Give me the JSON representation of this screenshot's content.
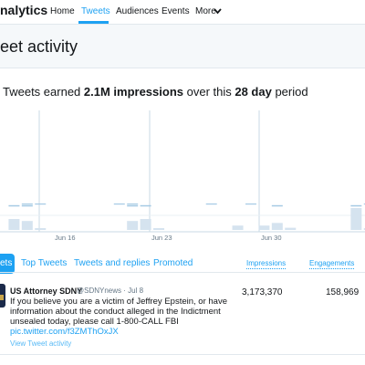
{
  "nav": {
    "brand": "nalytics",
    "items": [
      "Home",
      "Tweets",
      "Audiences",
      "Events",
      "More"
    ],
    "active": "Tweets"
  },
  "header": {
    "title": "eet activity"
  },
  "summary": {
    "prefix": "Tweets earned ",
    "impressions_value": "2.1M impressions",
    "middle": " over this ",
    "period": "28 day",
    "suffix": " period"
  },
  "chart_data": {
    "type": "bar",
    "x_tick_labels": [
      "Jun 16",
      "Jun 23",
      "Jun 30"
    ],
    "values": [
      0.0,
      0.5,
      0.41,
      0.05,
      0.0,
      0.0,
      0.0,
      0.0,
      0.0,
      0.0,
      0.41,
      0.5,
      0.05,
      0.0,
      0.0,
      0.0,
      0.0,
      0.0,
      0.2,
      0.0,
      0.2,
      0.32,
      0.1,
      0.0,
      0.0,
      0.0,
      0.0,
      1.0,
      0.05
    ],
    "series": [
      {
        "name": "impressions"
      }
    ],
    "grid": true,
    "colors": {
      "bar": "#d5e3ef",
      "grid": "#c9dae6",
      "organic_line": "#a6cbe4"
    }
  },
  "tabs": {
    "items": [
      "ets",
      "Top Tweets",
      "Tweets and replies",
      "Promoted"
    ],
    "active": "ets",
    "columns": [
      "Impressions",
      "Engagements"
    ]
  },
  "tweet": {
    "author": "US Attorney SDNY",
    "handle_date": "@SDNYnews · Jul 8",
    "text": "If you believe you are a victim of Jeffrey Epstein, or have information about the conduct alleged in the Indictment unsealed today, please call 1-800-CALL FBI",
    "link": "pic.twitter.com/f3ZMThOxJX",
    "view_activity": "View Tweet activity",
    "impressions": "3,173,370",
    "engagements": "158,969"
  },
  "colors": {
    "accent": "#1da1f2",
    "text": "#14171a",
    "muted": "#657786",
    "border": "#e1e8ed"
  }
}
